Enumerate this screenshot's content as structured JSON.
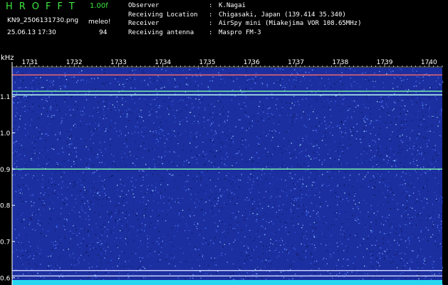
{
  "header": {
    "title": "HROFFT",
    "version": "1.00f",
    "filename": "KN9_2506131730.png",
    "timestamp": "25.06.13 17:30",
    "meleo_label": "meleo!",
    "meleo_value": "94"
  },
  "station": [
    {
      "key": "Observer",
      "sep": ":",
      "value": "K.Nagai"
    },
    {
      "key": "Receiving Location",
      "sep": ":",
      "value": "Chigasaki, Japan (139.414 35.340)"
    },
    {
      "key": "Receiver",
      "sep": ":",
      "value": "AirSpy mini (Miakejima VOR 108.65MHz)"
    },
    {
      "key": "Receiving antenna",
      "sep": ":",
      "value": "Maspro FM-3"
    }
  ],
  "colors": {
    "accent_green": "#3ee63e",
    "text": "#ffffff",
    "spectrogram_bg": "#1c2fa0",
    "bottom_strip": "#27d7f2"
  },
  "chart_data": {
    "type": "heatmap",
    "ylabel": "kHz",
    "x_ticks": [
      "1731",
      "1732",
      "1733",
      "1734",
      "1735",
      "1736",
      "1737",
      "1738",
      "1739",
      "1740"
    ],
    "y_ticks": [
      "1.1",
      "1.0",
      "0.9",
      "0.8",
      "0.7",
      "0.6"
    ],
    "y_tick_values": [
      1.1,
      1.0,
      0.9,
      0.8,
      0.7,
      0.6
    ],
    "ylim": [
      0.58,
      1.18
    ],
    "xlim": [
      1730.6,
      1740.3
    ],
    "carrier_lines": [
      {
        "freq": 1.16,
        "color": "#ff6a6a"
      },
      {
        "freq": 1.115,
        "color": "#7dffa8"
      },
      {
        "freq": 1.105,
        "color": "#b8fff0"
      },
      {
        "freq": 0.9,
        "color": "#7dffa8"
      },
      {
        "freq": 0.62,
        "color": "#d0d8ff"
      },
      {
        "freq": 0.605,
        "color": "#d0d8ff"
      }
    ]
  }
}
